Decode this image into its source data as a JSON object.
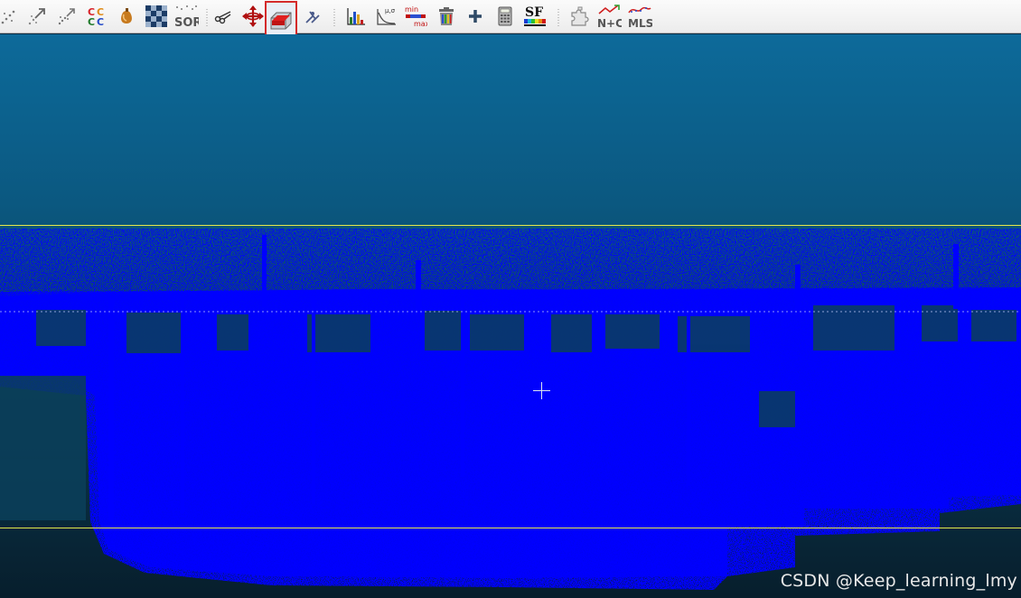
{
  "toolbar": {
    "tools": [
      {
        "id": "subsample",
        "icon": "point-subsample-icon"
      },
      {
        "id": "resample",
        "icon": "point-resample-icon"
      },
      {
        "id": "density",
        "icon": "point-density-icon"
      },
      {
        "id": "cc",
        "icon": "connected-components-icon",
        "label": "CC"
      },
      {
        "id": "noise",
        "icon": "noise-filter-icon"
      },
      {
        "id": "checker",
        "icon": "checkerboard-icon"
      },
      {
        "id": "sor",
        "icon": "sor-filter-icon",
        "label": "SOR"
      },
      {
        "id": "segment",
        "icon": "scissors-icon"
      },
      {
        "id": "translate",
        "icon": "translate-rotate-icon"
      },
      {
        "id": "crossSection",
        "icon": "cross-section-icon",
        "active": true
      },
      {
        "id": "pointPicking",
        "icon": "point-picking-icon"
      },
      {
        "id": "histogram",
        "icon": "histogram-icon"
      },
      {
        "id": "statFit",
        "icon": "statistics-fit-icon",
        "label": "μ,σ"
      },
      {
        "id": "filterMinMax",
        "icon": "filter-minmax-icon",
        "label_top": "min",
        "label_bottom": "max"
      },
      {
        "id": "deleteSF",
        "icon": "delete-scalar-field-icon"
      },
      {
        "id": "addConst",
        "icon": "add-constant-icon"
      },
      {
        "id": "calculator",
        "icon": "calculator-icon"
      },
      {
        "id": "sfColors",
        "icon": "scalar-field-colors-icon",
        "label": "SF"
      },
      {
        "id": "plugin",
        "icon": "plugin-puzzle-icon"
      },
      {
        "id": "normals",
        "icon": "normals-icon",
        "label": "N+C"
      },
      {
        "id": "mls",
        "icon": "mls-smoothing-icon",
        "label": "MLS"
      }
    ]
  },
  "viewport": {
    "background_top": "#0d6a9a",
    "background_bottom": "#071e2c",
    "point_color": "#0000ff",
    "guide_line_color": "#e6e84a"
  },
  "watermark": "CSDN @Keep_learning_lmy"
}
